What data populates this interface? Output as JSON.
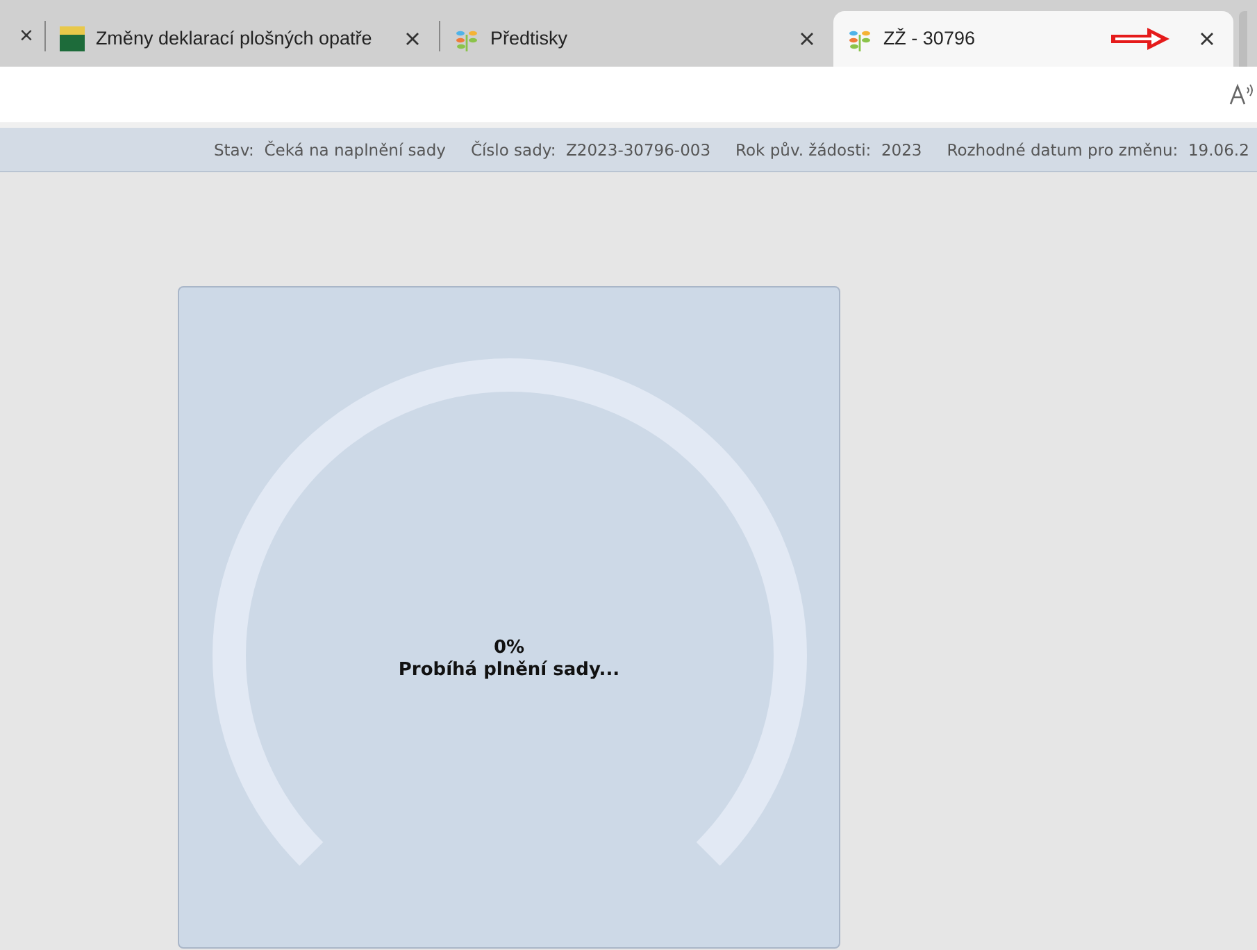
{
  "tabs": [
    {
      "label": "×",
      "kind": "close-stub",
      "selected": false
    },
    {
      "label": "Změny deklarací plošných opatře",
      "kind": "szif",
      "selected": false
    },
    {
      "label": "Předtisky",
      "kind": "sprout",
      "selected": false
    },
    {
      "label": "ZŽ - 30796",
      "kind": "sprout",
      "selected": true
    }
  ],
  "status_bar": [
    {
      "label": "Stav:",
      "value": "Čeká na naplnění sady"
    },
    {
      "label": "Číslo sady:",
      "value": "Z2023-30796-003"
    },
    {
      "label": "Rok pův. žádosti:",
      "value": "2023"
    },
    {
      "label": "Rozhodné datum pro změnu:",
      "value": "19.06.2"
    }
  ],
  "progress": {
    "percent": "0%",
    "message": "Probíhá plnění sady..."
  }
}
